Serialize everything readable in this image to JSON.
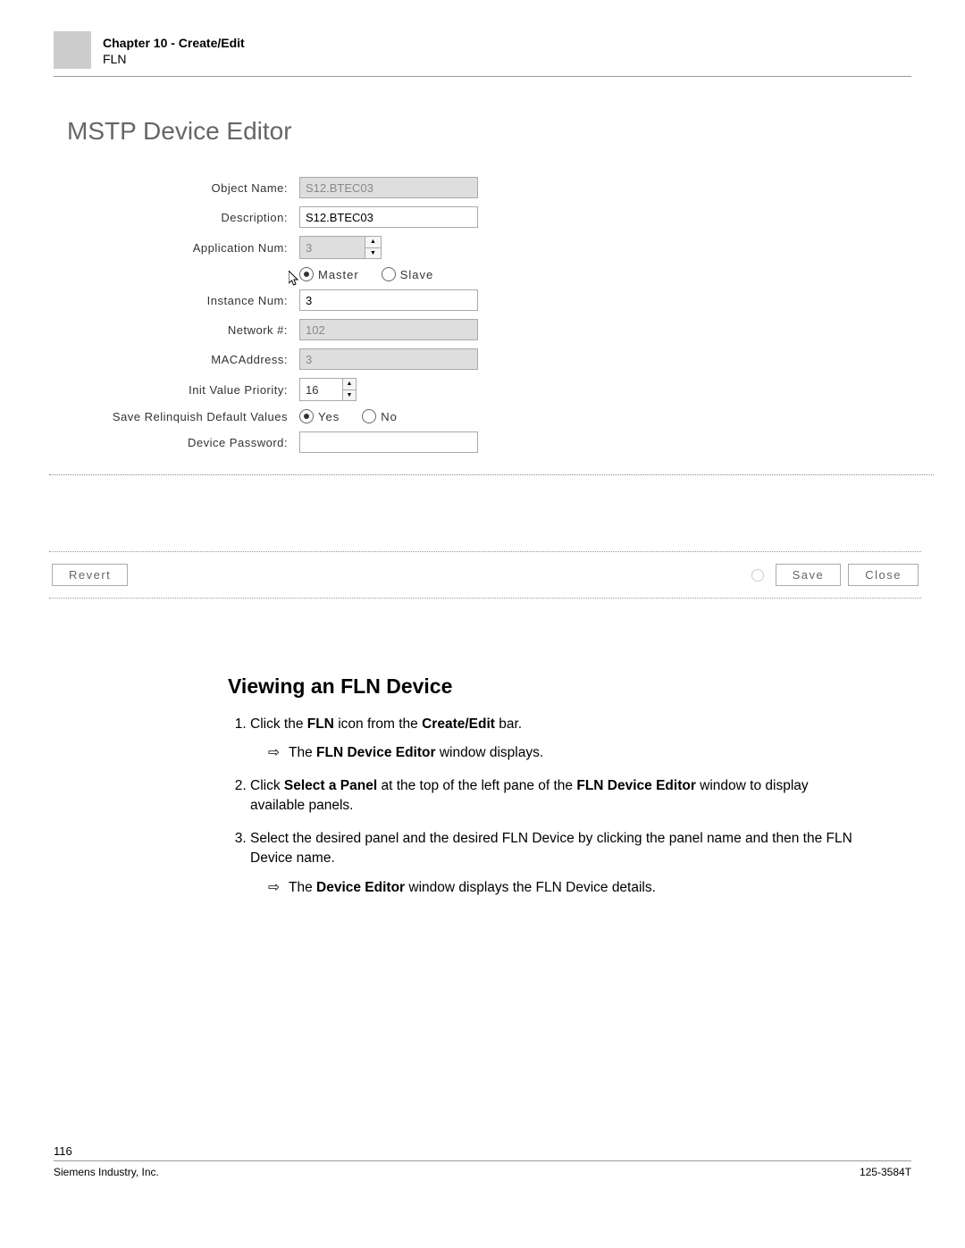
{
  "header": {
    "chapter": "Chapter 10 - Create/Edit",
    "subtitle": "FLN"
  },
  "editor": {
    "title": "MSTP Device Editor",
    "labels": {
      "object_name": "Object Name:",
      "description": "Description:",
      "application_num": "Application Num:",
      "instance_num": "Instance Num:",
      "network_num": "Network #:",
      "mac_address": "MACAddress:",
      "init_value_priority": "Init Value Priority:",
      "save_relinquish": "Save Relinquish Default Values",
      "device_password": "Device Password:"
    },
    "values": {
      "object_name": "S12.BTEC03",
      "description": "S12.BTEC03",
      "application_num": "3",
      "instance_num": "3",
      "network_num": "102",
      "mac_address": "3",
      "init_value_priority": "16",
      "device_password": ""
    },
    "radio_mode": {
      "master": "Master",
      "slave": "Slave",
      "selected": "master"
    },
    "radio_save": {
      "yes": "Yes",
      "no": "No",
      "selected": "yes"
    },
    "buttons": {
      "revert": "Revert",
      "save": "Save",
      "close": "Close"
    }
  },
  "doc_section": {
    "heading": "Viewing an FLN Device",
    "steps": {
      "s1_pre": "Click the ",
      "s1_b1": "FLN",
      "s1_mid": " icon from the ",
      "s1_b2": "Create/Edit",
      "s1_post": " bar.",
      "s1_sub_pre": "The ",
      "s1_sub_b": "FLN Device Editor",
      "s1_sub_post": " window displays.",
      "s2_pre": "Click ",
      "s2_b1": "Select a Panel",
      "s2_mid": " at the top of the left pane of the ",
      "s2_b2": "FLN Device Editor",
      "s2_post": " window to display available panels.",
      "s3": "Select the desired panel and the desired FLN Device by clicking the panel name and then the FLN Device name.",
      "s3_sub_pre": "The ",
      "s3_sub_b": "Device Editor",
      "s3_sub_post": " window displays the FLN Device details."
    }
  },
  "footer": {
    "page": "116",
    "company": "Siemens Industry, Inc.",
    "docnum": "125-3584T"
  }
}
